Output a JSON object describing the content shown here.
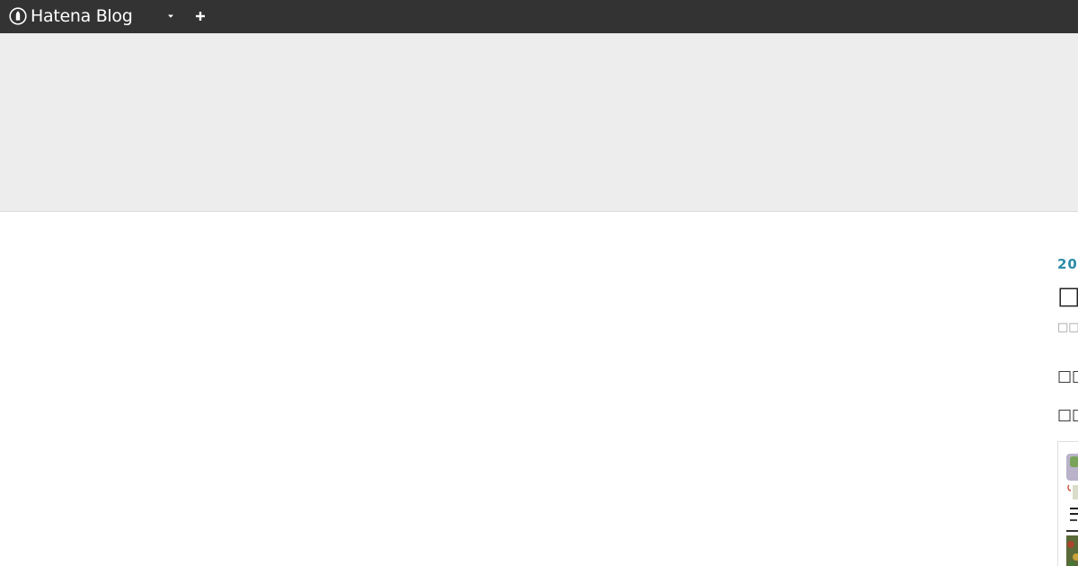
{
  "navbar": {
    "brand": "Hatena Blog",
    "brand_icon": "hatena-logo-icon",
    "dropdown_icon": "caret-down-icon",
    "add_icon": "plus-icon",
    "background": "#333333"
  },
  "header": {
    "background": "#ededed"
  },
  "entry": {
    "date": "20",
    "title": "□□",
    "category": "□□□",
    "heading_1": "□□□",
    "heading_2": "□□□",
    "date_color": "#2a8ca8"
  }
}
